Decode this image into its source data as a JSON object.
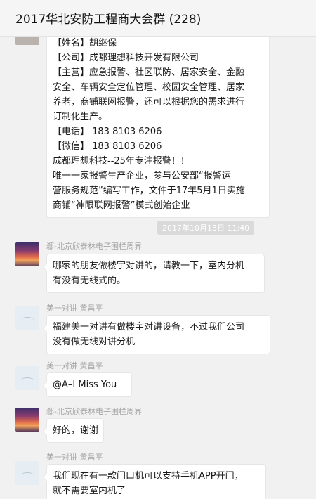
{
  "window": {
    "title": "2017华北安防工程商大会群 (228)"
  },
  "messages": [
    {
      "lines": [
        "【姓名】胡继保",
        "【公司】成都理想科技开发有限公司",
        "【主营】应急报警、社区联防、居家安全、金融",
        "安全、车辆安全定位管理、校园安全管理、居家",
        "养老，商铺联网报警，还可以根据您的需求进行",
        "订制化生产。",
        "【电话】 183 8103 6206",
        "【微信】 183 8103 6206",
        "成都理想科技--25年专注报警！！",
        "    唯一一家报警生产企业，参与公安部“报警运",
        "营服务规范”编写工作，文件于17年5月1日实施",
        "    商铺“神眼联网报警”模式创始企业"
      ]
    },
    {
      "timestamp": "2017年10月13日 11:40"
    },
    {
      "sender": "郄-北京欣泰林电子围栏周界",
      "lines": [
        "哪家的朋友做楼宇对讲的，请教一下，室内分机",
        "有没有无线式的。"
      ]
    },
    {
      "sender": "美一对讲 黄昌平",
      "lines": [
        "  福建美一对讲有做楼宇对讲设备，不过我们公司",
        "没有做无线对讲分机"
      ]
    },
    {
      "sender": "美一对讲 黄昌平",
      "lines": [
        "@A–I Miss You"
      ]
    },
    {
      "sender": "郄-北京欣泰林电子围栏周界",
      "lines": [
        "好的，谢谢"
      ]
    },
    {
      "sender": "美一对讲 黄昌平",
      "lines": [
        "我们现在有一款门口机可以支持手机APP开门，",
        "就不需要室内机了"
      ]
    }
  ]
}
